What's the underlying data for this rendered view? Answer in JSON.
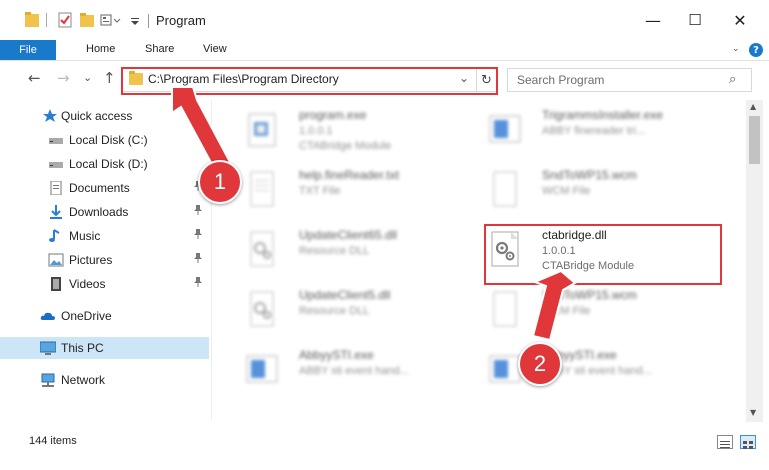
{
  "window": {
    "title": "Program",
    "minimize_glyph": "—",
    "maximize_glyph": "☐",
    "close_glyph": "✕"
  },
  "ribbon": {
    "file": "File",
    "home": "Home",
    "share": "Share",
    "view": "View",
    "expand_glyph": "⌄",
    "help_glyph": "?"
  },
  "nav": {
    "back_glyph": "←",
    "forward_glyph": "→",
    "recent_glyph": "⌄",
    "up_glyph": "↑",
    "address": "C:\\Program Files\\Program Directory",
    "dropdown_glyph": "⌄",
    "refresh_glyph": "↻",
    "search_placeholder": "Search Program",
    "search_glyph": "⌕"
  },
  "sidebar": {
    "items": [
      {
        "label": "Quick access",
        "icon": "star-icon",
        "pinned": false
      },
      {
        "label": "Local Disk (C:)",
        "icon": "drive-icon",
        "pinned": true
      },
      {
        "label": "Local Disk (D:)",
        "icon": "drive-icon",
        "pinned": true
      },
      {
        "label": "Documents",
        "icon": "documents-icon",
        "pinned": true
      },
      {
        "label": "Downloads",
        "icon": "download-icon",
        "pinned": true
      },
      {
        "label": "Music",
        "icon": "music-icon",
        "pinned": true
      },
      {
        "label": "Pictures",
        "icon": "pictures-icon",
        "pinned": true
      },
      {
        "label": "Videos",
        "icon": "videos-icon",
        "pinned": true
      },
      {
        "label": "OneDrive",
        "icon": "cloud-icon",
        "pinned": false
      },
      {
        "label": "This PC",
        "icon": "computer-icon",
        "pinned": false,
        "selected": true
      },
      {
        "label": "Network",
        "icon": "network-icon",
        "pinned": false
      }
    ],
    "pin_glyph": "📌"
  },
  "files": [
    {
      "name": "program.exe",
      "line2": "1.0.0.1",
      "line3": "CTABridge Module",
      "icon": "exe-icon"
    },
    {
      "name": "TrigrammsInstaller.exe",
      "line2": "ABBY finereader tri...",
      "line3": "",
      "icon": "installer-icon"
    },
    {
      "name": "help.fineReader.txt",
      "line2": "TXT File",
      "line3": "",
      "icon": "txt-icon"
    },
    {
      "name": "SndToWP15.wcm",
      "line2": "WCM File",
      "line3": "",
      "icon": "file-icon"
    },
    {
      "name": "UpdateClient65.dll",
      "line2": "Resource DLL",
      "line3": "",
      "icon": "dll-icon"
    },
    {
      "name": "ctabridge.dll",
      "line2": "1.0.0.1",
      "line3": "CTABridge Module",
      "icon": "dll-icon"
    },
    {
      "name": "UpdateClient5.dll",
      "line2": "Resource DLL",
      "line3": "",
      "icon": "dll-icon"
    },
    {
      "name": "SndToWP15.wcm",
      "line2": "WCM File",
      "line3": "",
      "icon": "file-icon"
    },
    {
      "name": "AbbyySTI.exe",
      "line2": "ABBY sti event hand...",
      "line3": "",
      "icon": "installer-icon"
    },
    {
      "name": "AbbyySTI.exe",
      "line2": "ABBY sti event hand...",
      "line3": "",
      "icon": "installer-icon"
    }
  ],
  "status": {
    "item_count": "144 items"
  },
  "callouts": {
    "step1": "1",
    "step2": "2",
    "accent": "#e0373b"
  }
}
